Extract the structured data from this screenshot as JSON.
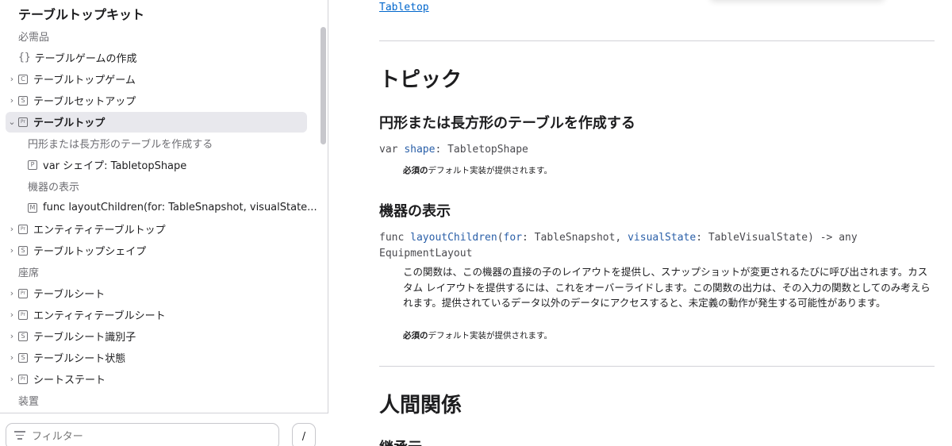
{
  "sidebar": {
    "title": "テーブルトップキット",
    "items": [
      {
        "kind": "section",
        "label": "必需品"
      },
      {
        "kind": "item",
        "icon": "braces",
        "label": "テーブルゲームの作成"
      },
      {
        "kind": "item",
        "chevron": "›",
        "icon": "C",
        "label": "テーブルトップゲーム"
      },
      {
        "kind": "item",
        "chevron": "›",
        "icon": "S",
        "label": "テーブルセットアップ"
      },
      {
        "kind": "item",
        "chevron": "⌄",
        "icon": "Pr",
        "label": "テーブルトップ",
        "selected": true
      },
      {
        "kind": "sub-section",
        "label": "円形または長方形のテーブルを作成する"
      },
      {
        "kind": "sub-item",
        "icon": "P",
        "label": "var シェイプ: TabletopShape"
      },
      {
        "kind": "sub-section",
        "label": "機器の表示"
      },
      {
        "kind": "sub-item",
        "icon": "M",
        "label": "func layoutChildren(for: TableSnapshot, visualState..."
      },
      {
        "kind": "item",
        "chevron": "›",
        "icon": "Pr",
        "label": "エンティティテーブルトップ"
      },
      {
        "kind": "item",
        "chevron": "›",
        "icon": "S",
        "label": "テーブルトップシェイプ"
      },
      {
        "kind": "section",
        "label": "座席"
      },
      {
        "kind": "item",
        "chevron": "›",
        "icon": "Pr",
        "label": "テーブルシート"
      },
      {
        "kind": "item",
        "chevron": "›",
        "icon": "Pr",
        "label": "エンティティテーブルシート"
      },
      {
        "kind": "item",
        "chevron": "›",
        "icon": "S",
        "label": "テーブルシート識別子"
      },
      {
        "kind": "item",
        "chevron": "›",
        "icon": "S",
        "label": "テーブルシート状態"
      },
      {
        "kind": "item",
        "chevron": "›",
        "icon": "Pr",
        "label": "シートステート"
      },
      {
        "kind": "section",
        "label": "装置"
      }
    ],
    "filter_placeholder": "フィルター",
    "slash_label": "/"
  },
  "main": {
    "top_link": "Tabletop",
    "topics_heading": "トピック",
    "group1_heading": "円形または長方形のテーブルを作成する",
    "code1": {
      "kw": "var",
      "name": "shape",
      "rest": ": TabletopShape"
    },
    "note_bold": "必須の",
    "note_rest": "デフォルト実装が提供されます。",
    "group2_heading": "機器の表示",
    "code2": {
      "kw": "func",
      "name": "layoutChildren",
      "p1": "(",
      "label1": "for",
      "p2": ": TableSnapshot, ",
      "label2": "visualState",
      "p3": ": TableVisualState) -> any",
      "line2": "EquipmentLayout"
    },
    "description": "この関数は、この機器の直接の子のレイアウトを提供し、スナップショットが変更されるたびに呼び出されます。カスタム レイアウトを提供するには、これをオーバーライドします。この関数の出力は、その入力の関数としてのみ考えられます。提供されているデータ以外のデータにアクセスすると、未定義の動作が発生する可能性があります。",
    "relations_heading": "人間関係",
    "inherits_heading": "継承元"
  },
  "colors": {
    "link": "#0066cc",
    "selected_bg": "#e8e8ed",
    "code_identifier": "#2a5fa8",
    "divider": "#d2d2d7"
  }
}
